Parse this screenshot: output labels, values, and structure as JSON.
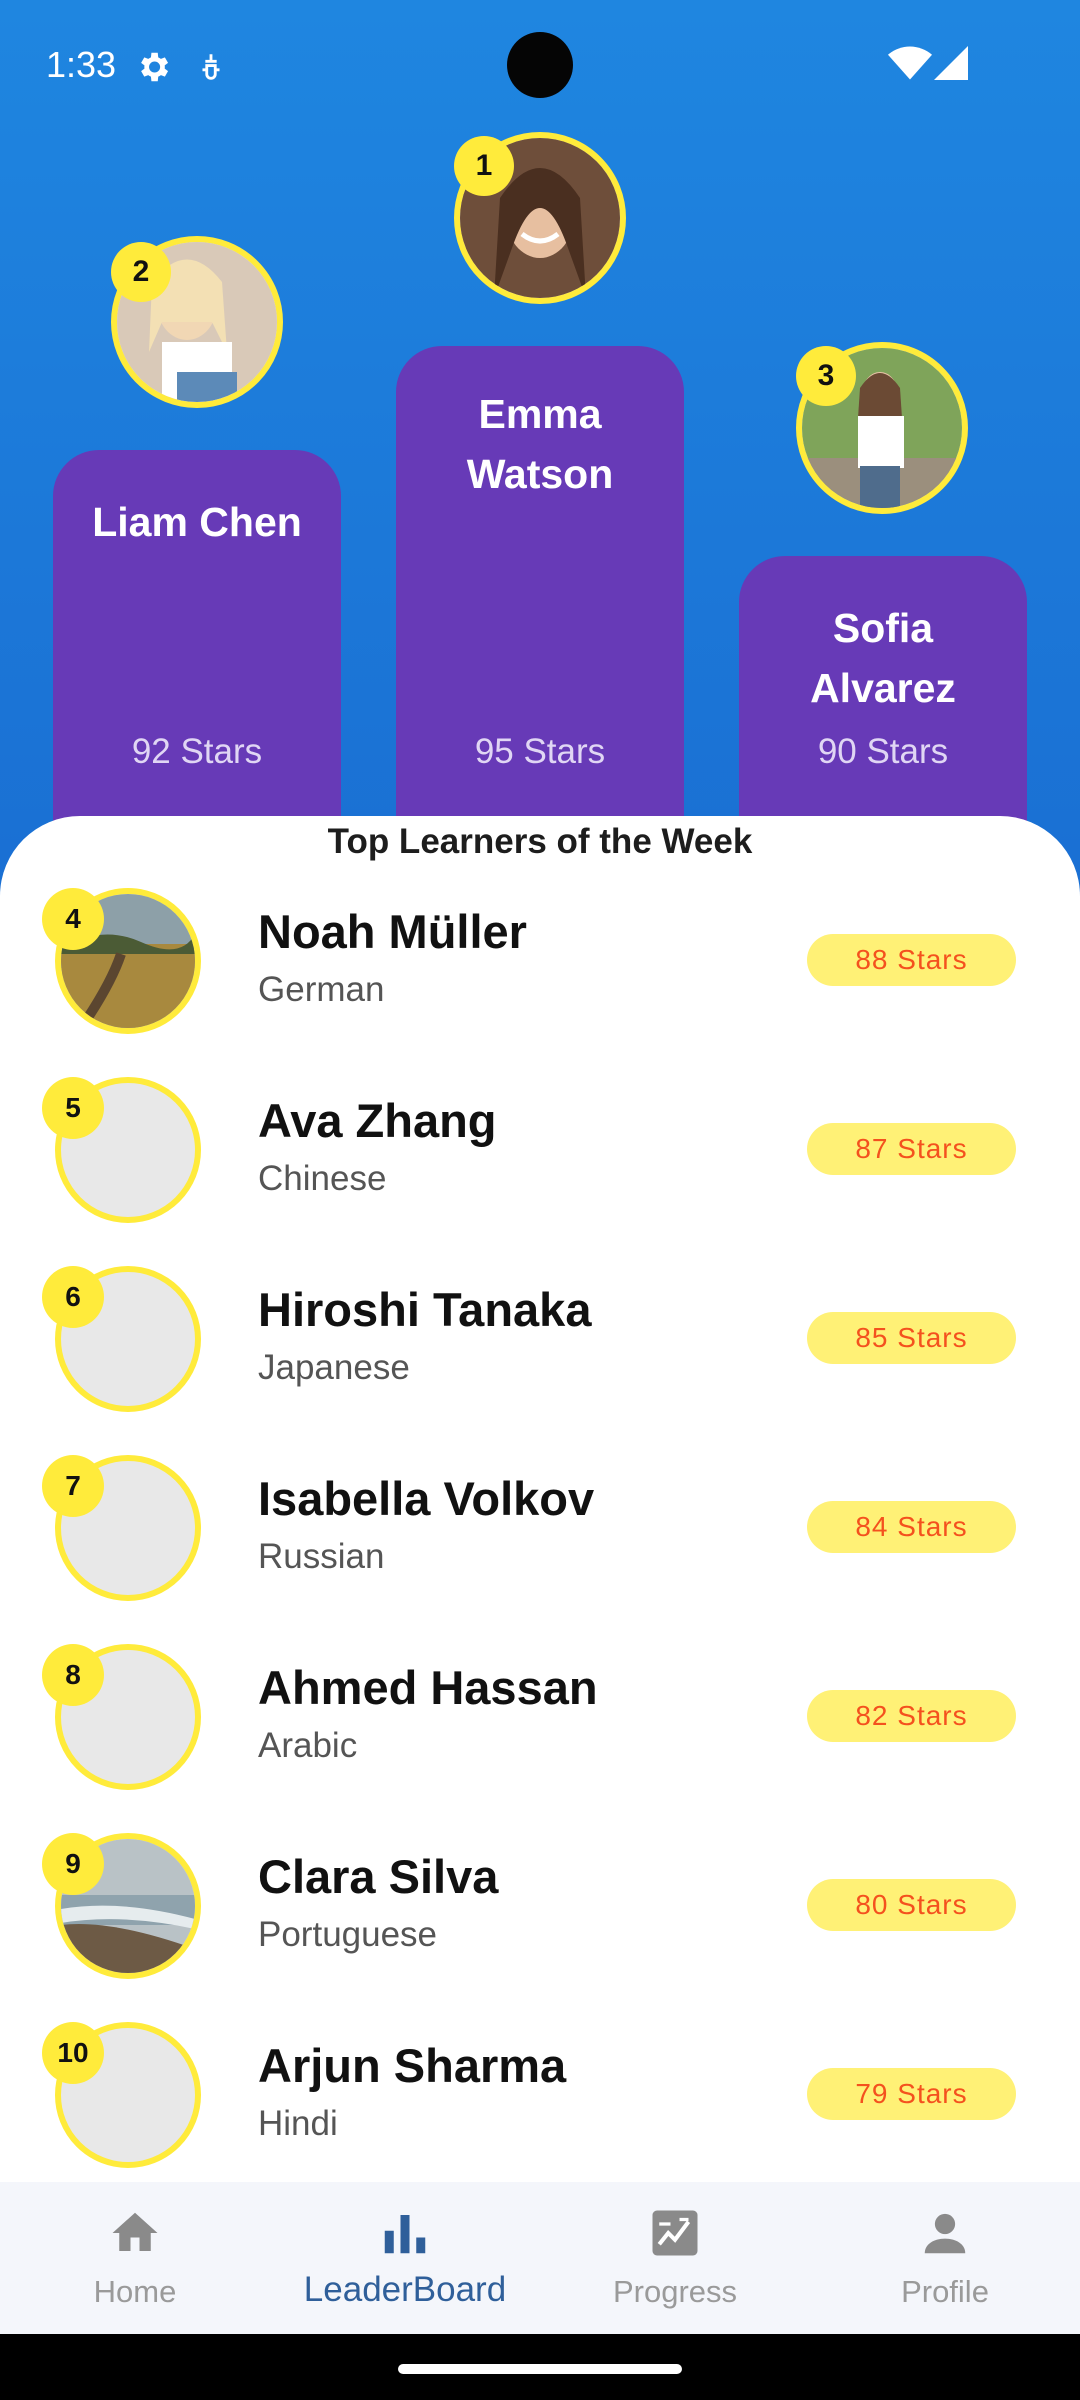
{
  "status_bar": {
    "time": "1:33"
  },
  "podium": {
    "first": {
      "rank": "1",
      "name": "Emma Watson",
      "stars": "95 Stars"
    },
    "second": {
      "rank": "2",
      "name": "Liam Chen",
      "stars": "92 Stars"
    },
    "third": {
      "rank": "3",
      "name": "Sofia Alvarez",
      "stars": "90 Stars"
    }
  },
  "section_title": "Top Learners of the Week",
  "learners": [
    {
      "rank": "4",
      "name": "Noah Müller",
      "language": "German",
      "stars": "88 Stars"
    },
    {
      "rank": "5",
      "name": "Ava Zhang",
      "language": "Chinese",
      "stars": "87 Stars"
    },
    {
      "rank": "6",
      "name": "Hiroshi Tanaka",
      "language": "Japanese",
      "stars": "85 Stars"
    },
    {
      "rank": "7",
      "name": "Isabella Volkov",
      "language": "Russian",
      "stars": "84 Stars"
    },
    {
      "rank": "8",
      "name": "Ahmed Hassan",
      "language": "Arabic",
      "stars": "82 Stars"
    },
    {
      "rank": "9",
      "name": "Clara Silva",
      "language": "Portuguese",
      "stars": "80 Stars"
    },
    {
      "rank": "10",
      "name": "Arjun Sharma",
      "language": "Hindi",
      "stars": "79 Stars"
    }
  ],
  "bottom_nav": [
    {
      "label": "Home",
      "icon": "home-icon",
      "active": false
    },
    {
      "label": "LeaderBoard",
      "icon": "leaderboard-icon",
      "active": true
    },
    {
      "label": "Progress",
      "icon": "progress-icon",
      "active": false
    },
    {
      "label": "Profile",
      "icon": "profile-icon",
      "active": false
    }
  ],
  "colors": {
    "header_blue": "#1f86e0",
    "podium_purple": "#673ab7",
    "badge_yellow": "#ffeb3b",
    "pill_yellow": "#fff176",
    "pill_text_orange": "#f4511e",
    "nav_active": "#2f5f9a"
  }
}
